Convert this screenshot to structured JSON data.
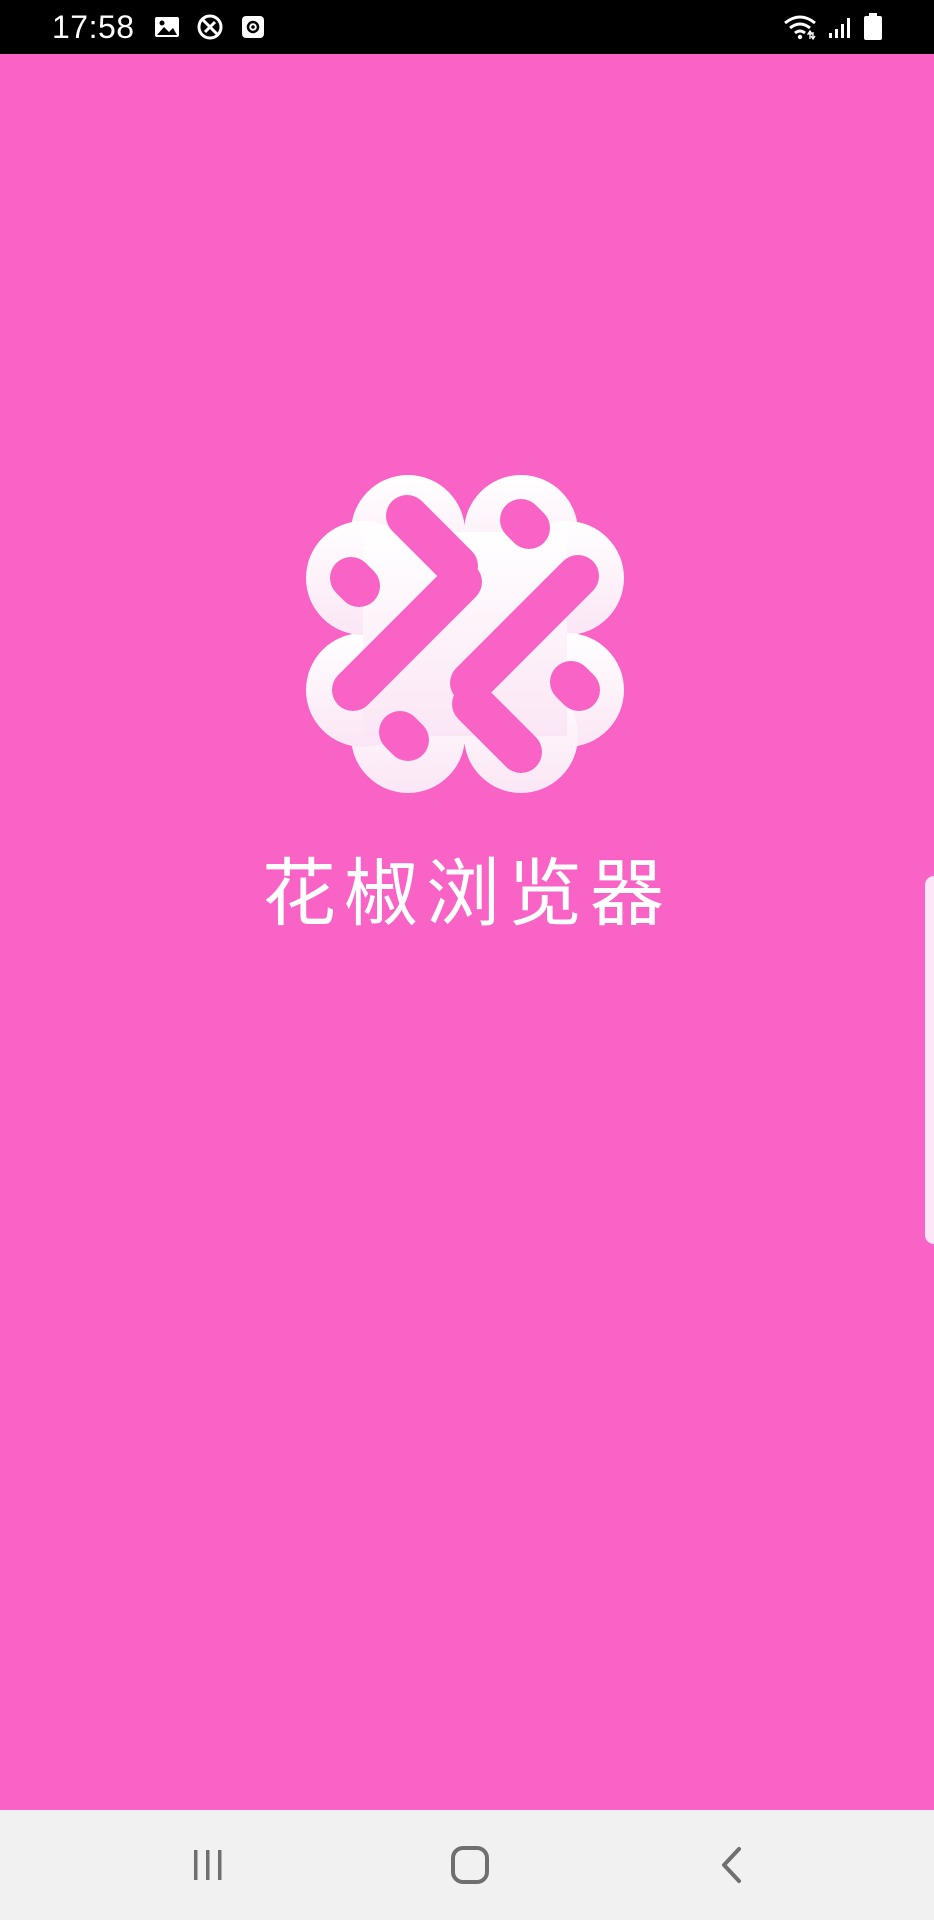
{
  "status_bar": {
    "time": "17:58",
    "left_icons": [
      "image-icon",
      "blocked-icon",
      "screen-record-icon"
    ],
    "right_icons": [
      "wifi-icon",
      "signal-icon",
      "battery-icon"
    ]
  },
  "splash": {
    "app_name": "花椒浏览器",
    "logo_icon": "flower-logo-icon",
    "background_color": "#f963c5"
  },
  "nav_bar": {
    "buttons": [
      "recent-apps",
      "home",
      "back"
    ]
  }
}
